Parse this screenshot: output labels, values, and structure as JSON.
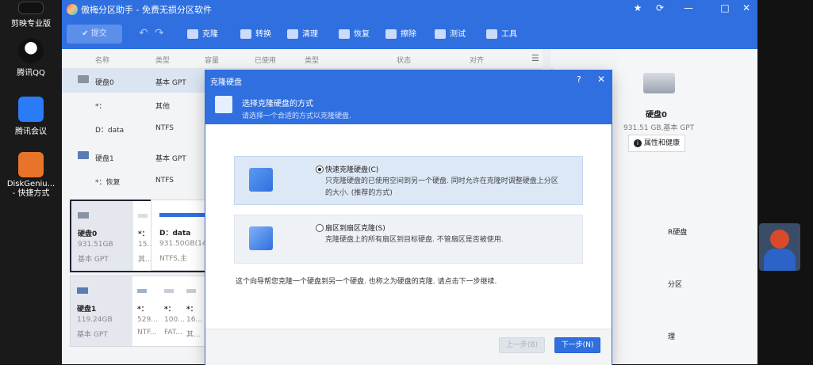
{
  "desktop": {
    "icons": [
      {
        "label": "剪映专业版"
      },
      {
        "label": "腾讯QQ"
      },
      {
        "label": "腾讯会议"
      },
      {
        "label": "DiskGeniu...\n- 快捷方式"
      }
    ]
  },
  "app": {
    "title": "傲梅分区助手 - 免费无损分区软件",
    "window_controls": [
      "★",
      "⟳",
      "—",
      "□",
      "✕"
    ],
    "toolbar": {
      "submit": "提交",
      "undo": "↶",
      "redo": "↷",
      "items": [
        "克隆",
        "转换",
        "清理",
        "恢复",
        "擦除",
        "测试",
        "工具"
      ]
    },
    "columns": [
      "名称",
      "类型",
      "容量",
      "已使用",
      "类型",
      "状态",
      "对齐"
    ],
    "rows": [
      {
        "name": "硬盘0",
        "type": "基本 GPT"
      },
      {
        "name": "*：",
        "type": "其他"
      },
      {
        "name": "D：data",
        "type": "NTFS"
      },
      {
        "name": "硬盘1",
        "type": "基本 GPT"
      },
      {
        "name": "*：恢复",
        "type": "NTFS"
      }
    ],
    "disk_cards": [
      {
        "name": "硬盘0",
        "size": "931.51GB",
        "kind": "基本 GPT",
        "p1_label": "*：",
        "p1_size": "15...",
        "p1_type": "其...",
        "p2_label": "D：data",
        "p2_size": "931.50GB(14",
        "p2_type": "NTFS,主"
      },
      {
        "name": "硬盘1",
        "size": "119.24GB",
        "kind": "基本 GPT",
        "p1_label": "*：",
        "p1_size": "529...",
        "p1_type": "NTF...",
        "p2_label": "*：",
        "p2_size": "100...",
        "p2_type": "FAT...",
        "p3_label": "*：",
        "p3_size": "16...",
        "p3_type": "其..."
      }
    ],
    "info_panel": {
      "disk_name": "硬盘0",
      "disk_detail": "931.51 GB,基本 GPT",
      "attr_button": "属性和健康",
      "cut_texts": [
        "R硬盘",
        "分区",
        "理"
      ]
    }
  },
  "dialog": {
    "title": "克隆硬盘",
    "help": "?",
    "close": "✕",
    "header_title": "选择克隆硬盘的方式",
    "header_sub": "请选择一个合适的方式以克隆硬盘.",
    "options": [
      {
        "label": "快速克隆硬盘(C)",
        "desc": "只克隆硬盘的已使用空间到另一个硬盘. 同时允许在克隆时调整硬盘上分区的大小. (推荐的方式)",
        "selected": true
      },
      {
        "label": "扇区到扇区克隆(S)",
        "desc": "克隆硬盘上的所有扇区到目标硬盘. 不管扇区是否被使用.",
        "selected": false
      }
    ],
    "note": "这个向导帮您克隆一个硬盘到另一个硬盘. 也称之为硬盘的克隆. 请点击下一步继续.",
    "prev": "上一步(B)",
    "next": "下一步(N)"
  },
  "colors": {
    "accent": "#2f6fe0",
    "selected_option": "#dce8f6"
  }
}
